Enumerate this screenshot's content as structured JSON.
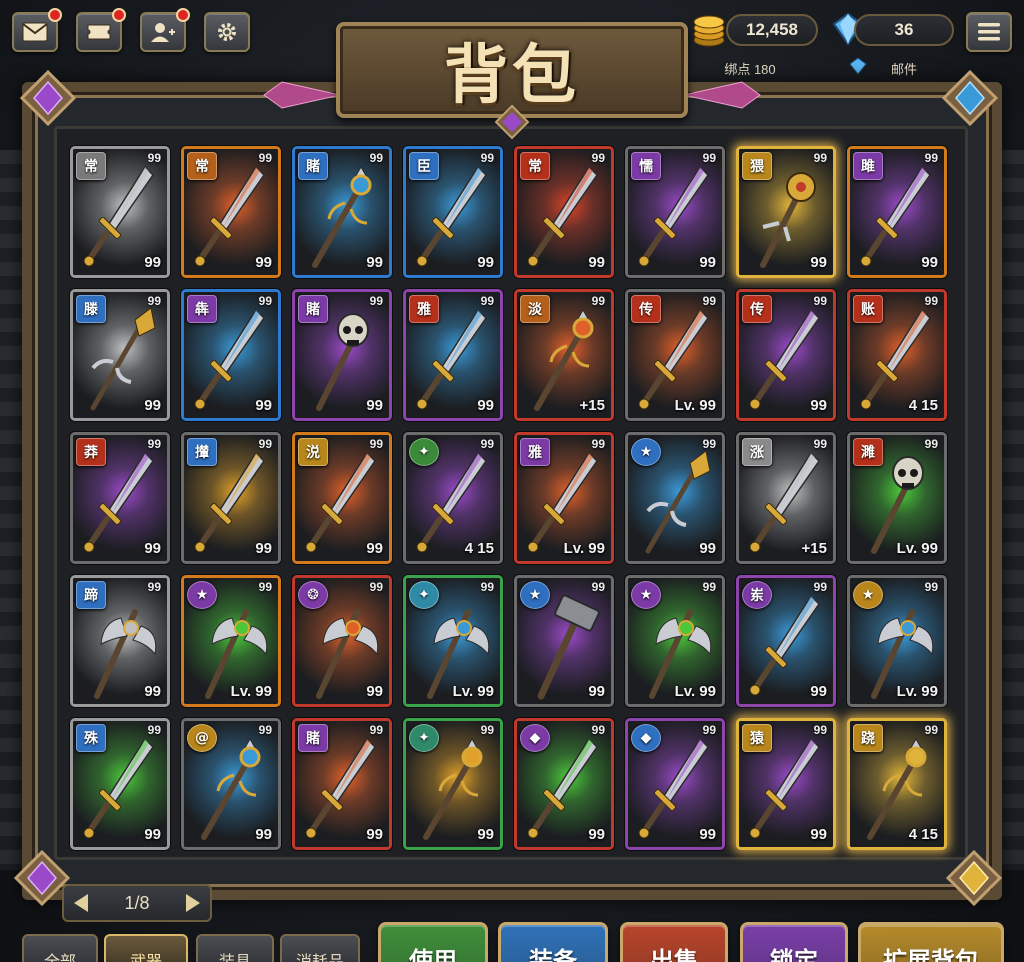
{
  "top_bar": {
    "buttons": [
      {
        "name": "mail-button",
        "icon": "envelope-icon",
        "dot": true
      },
      {
        "name": "ticket-button",
        "icon": "ticket-icon",
        "dot": true
      },
      {
        "name": "friends-button",
        "icon": "friends-icon",
        "dot": true
      },
      {
        "name": "settings-button",
        "icon": "gear-icon",
        "dot": false
      }
    ],
    "gold": {
      "value": "12,458",
      "sub": "绑点 180",
      "icon": "coin-stack-icon"
    },
    "gems": {
      "value": "36",
      "icon": "diamond-icon"
    },
    "mail_label": "邮件",
    "menu_icon": "hamburger-menu-icon"
  },
  "title": "背包",
  "rarity_colors": {
    "white": "#9a9a9a",
    "orange": "#d27a1c",
    "blue": "#2f7ad1",
    "red": "#c0392b",
    "purple": "#8e44ad",
    "gold": "#e0b43a",
    "green": "#3aa34a",
    "gray": "#6c6c6c"
  },
  "items": [
    {
      "badge": "常",
      "badge_color": "#7a7a7a",
      "border": "white",
      "glow": "#bfbfbf",
      "type": "sword",
      "top": "99",
      "bottom": "99"
    },
    {
      "badge": "常",
      "badge_color": "#b5601a",
      "border": "orange",
      "glow": "#e0602a",
      "type": "sword",
      "top": "99",
      "bottom": "99"
    },
    {
      "badge": "賭",
      "badge_color": "#2f6fc0",
      "border": "blue",
      "glow": "#3a9ad8",
      "type": "staff",
      "top": "99",
      "bottom": "99"
    },
    {
      "badge": "臣",
      "badge_color": "#2f6fc0",
      "border": "blue",
      "glow": "#3a9ad8",
      "type": "sword",
      "top": "99",
      "bottom": "99"
    },
    {
      "badge": "常",
      "badge_color": "#b5301a",
      "border": "red",
      "glow": "#d8442a",
      "type": "sword",
      "top": "99",
      "bottom": "99"
    },
    {
      "badge": "懦",
      "badge_color": "#7b3aa6",
      "border": "gray",
      "glow": "#9a4ac8",
      "type": "sword",
      "top": "99",
      "bottom": "99"
    },
    {
      "badge": "猥",
      "badge_color": "#b8861a",
      "border": "gold",
      "glow": "#e0b43a",
      "type": "mace",
      "top": "99",
      "bottom": "99",
      "glowing": true
    },
    {
      "badge": "雎",
      "badge_color": "#7b3aa6",
      "border": "orange",
      "glow": "#9a4ac8",
      "type": "sword",
      "top": "99",
      "bottom": "99"
    },
    {
      "badge": "滕",
      "badge_color": "#2f6fc0",
      "border": "white",
      "glow": "#bfbfbf",
      "type": "spear",
      "top": "99",
      "bottom": "99"
    },
    {
      "badge": "犇",
      "badge_color": "#7b3aa6",
      "border": "blue",
      "glow": "#3a9ad8",
      "type": "sword",
      "top": "99",
      "bottom": "99"
    },
    {
      "badge": "賭",
      "badge_color": "#7b3aa6",
      "border": "purple",
      "glow": "#9a4ac8",
      "type": "skull",
      "top": "99",
      "bottom": "99"
    },
    {
      "badge": "雅",
      "badge_color": "#b5301a",
      "border": "purple",
      "glow": "#3a9ad8",
      "type": "sword",
      "top": "99",
      "bottom": "99"
    },
    {
      "badge": "淡",
      "badge_color": "#b5601a",
      "border": "red",
      "glow": "#e0602a",
      "type": "staff",
      "top": "99",
      "bottom": "+15"
    },
    {
      "badge": "传",
      "badge_color": "#b5301a",
      "border": "gray",
      "glow": "#e0602a",
      "type": "sword",
      "top": "99",
      "bottom": "Lv. 99"
    },
    {
      "badge": "传",
      "badge_color": "#b5301a",
      "border": "red",
      "glow": "#9a4ac8",
      "type": "sword",
      "top": "99",
      "bottom": "99"
    },
    {
      "badge": "账",
      "badge_color": "#b5301a",
      "border": "red",
      "glow": "#e0602a",
      "type": "sword",
      "top": "99",
      "bottom": "4 15"
    },
    {
      "badge": "莽",
      "badge_color": "#b5301a",
      "border": "gray",
      "glow": "#9a4ac8",
      "type": "sword",
      "top": "99",
      "bottom": "99"
    },
    {
      "badge": "攆",
      "badge_color": "#2f6fc0",
      "border": "gray",
      "glow": "#e0a02a",
      "type": "sword",
      "top": "99",
      "bottom": "99"
    },
    {
      "badge": "涚",
      "badge_color": "#b8861a",
      "border": "orange",
      "glow": "#e0602a",
      "type": "sword",
      "top": "99",
      "bottom": "99"
    },
    {
      "badge": "✦",
      "badge_color": "#3a8a3a",
      "border": "gray",
      "glow": "#9a4ac8",
      "type": "sword",
      "top": "99",
      "bottom": "4 15",
      "round": true
    },
    {
      "badge": "雅",
      "badge_color": "#7b3aa6",
      "border": "red",
      "glow": "#e0602a",
      "type": "sword",
      "top": "99",
      "bottom": "Lv. 99"
    },
    {
      "badge": "★",
      "badge_color": "#2f6fc0",
      "border": "gray",
      "glow": "#3a9ad8",
      "type": "spear",
      "top": "99",
      "bottom": "99",
      "round": true
    },
    {
      "badge": "涨",
      "badge_color": "#8a8a8a",
      "border": "gray",
      "glow": "#bfbfbf",
      "type": "sword",
      "top": "99",
      "bottom": "+15"
    },
    {
      "badge": "濉",
      "badge_color": "#b5301a",
      "border": "gray",
      "glow": "#4ac83a",
      "type": "skull",
      "top": "99",
      "bottom": "Lv. 99"
    },
    {
      "badge": "蹄",
      "badge_color": "#2f6fc0",
      "border": "white",
      "glow": "#bfbfbf",
      "type": "axe",
      "top": "99",
      "bottom": "99"
    },
    {
      "badge": "★",
      "badge_color": "#7b3aa6",
      "border": "orange",
      "glow": "#4ac83a",
      "type": "axe",
      "top": "99",
      "bottom": "Lv. 99",
      "round": true
    },
    {
      "badge": "❂",
      "badge_color": "#7b3aa6",
      "border": "red",
      "glow": "#e0602a",
      "type": "axe",
      "top": "99",
      "bottom": "99",
      "round": true
    },
    {
      "badge": "✦",
      "badge_color": "#2f8aa6",
      "border": "green",
      "glow": "#3a9ad8",
      "type": "axe",
      "top": "99",
      "bottom": "Lv. 99",
      "round": true
    },
    {
      "badge": "★",
      "badge_color": "#2f6fc0",
      "border": "gray",
      "glow": "#9a4ac8",
      "type": "hammer",
      "top": "99",
      "bottom": "99",
      "round": true
    },
    {
      "badge": "★",
      "badge_color": "#7b3aa6",
      "border": "gray",
      "glow": "#4ac83a",
      "type": "axe",
      "top": "99",
      "bottom": "Lv. 99",
      "round": true
    },
    {
      "badge": "岽",
      "badge_color": "#7b3aa6",
      "border": "purple",
      "glow": "#3a9ad8",
      "type": "sword",
      "top": "99",
      "bottom": "99",
      "round": true
    },
    {
      "badge": "★",
      "badge_color": "#b8861a",
      "border": "gray",
      "glow": "#3a9ad8",
      "type": "axe",
      "top": "99",
      "bottom": "Lv. 99",
      "round": true
    },
    {
      "badge": "殊",
      "badge_color": "#2f6fc0",
      "border": "white",
      "glow": "#4ac83a",
      "type": "sword",
      "top": "99",
      "bottom": "99"
    },
    {
      "badge": "@",
      "badge_color": "#b8861a",
      "border": "gray",
      "glow": "#3a9ad8",
      "type": "staff",
      "top": "99",
      "bottom": "99",
      "round": true
    },
    {
      "badge": "賭",
      "badge_color": "#7b3aa6",
      "border": "red",
      "glow": "#e0602a",
      "type": "sword",
      "top": "99",
      "bottom": "99"
    },
    {
      "badge": "✦",
      "badge_color": "#2f8a6a",
      "border": "green",
      "glow": "#e0a02a",
      "type": "staff",
      "top": "99",
      "bottom": "99",
      "round": true
    },
    {
      "badge": "◆",
      "badge_color": "#7b3aa6",
      "border": "red",
      "glow": "#4ac83a",
      "type": "sword",
      "top": "99",
      "bottom": "99",
      "round": true
    },
    {
      "badge": "◆",
      "badge_color": "#2f6fc0",
      "border": "purple",
      "glow": "#9a4ac8",
      "type": "sword",
      "top": "99",
      "bottom": "99",
      "round": true
    },
    {
      "badge": "猿",
      "badge_color": "#b8861a",
      "border": "gold",
      "glow": "#9a4ac8",
      "type": "sword",
      "top": "99",
      "bottom": "99",
      "glowing": true
    },
    {
      "badge": "跷",
      "badge_color": "#b8861a",
      "border": "gold",
      "glow": "#e0b43a",
      "type": "staff",
      "top": "99",
      "bottom": "4 15",
      "glowing": true
    }
  ],
  "pager": {
    "text": "1/8"
  },
  "tabs": [
    "全部",
    "武器",
    "装具",
    "消耗品"
  ],
  "active_tab": 1,
  "actions": [
    {
      "label": "使用",
      "color": "#3f8f3a"
    },
    {
      "label": "装备",
      "color": "#2f72b8"
    },
    {
      "label": "出售",
      "color": "#b8452a"
    },
    {
      "label": "锁定",
      "color": "#7a3fa8"
    },
    {
      "label": "扩展背包",
      "color": "#b58a2a"
    }
  ]
}
